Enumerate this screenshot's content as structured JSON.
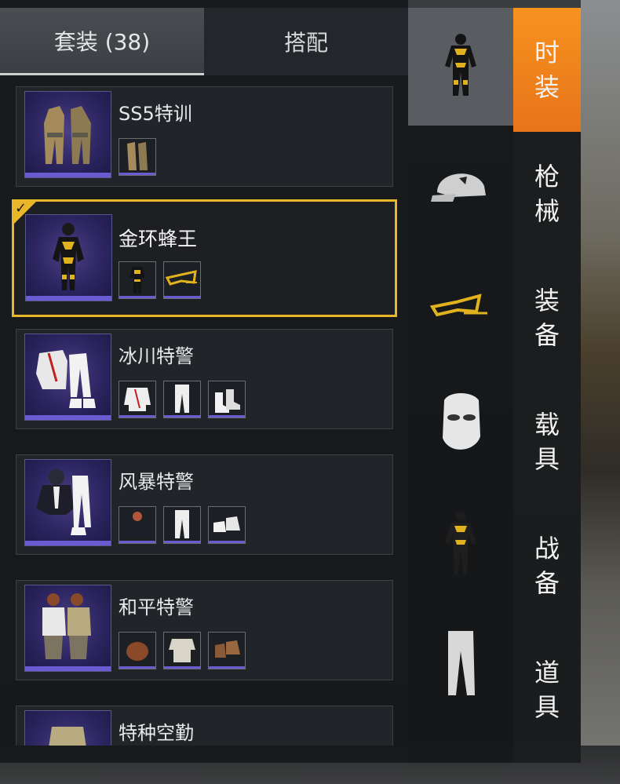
{
  "tabs": [
    {
      "label": "套装 (38)",
      "active": true
    },
    {
      "label": "搭配",
      "active": false
    }
  ],
  "outfits": [
    {
      "name": "SS5特训",
      "selected": false,
      "items": [
        "camo-suit-item"
      ]
    },
    {
      "name": "金环蜂王",
      "selected": true,
      "items": [
        "gold-suit-item",
        "gold-mask-item"
      ]
    },
    {
      "name": "冰川特警",
      "selected": false,
      "items": [
        "white-jacket-item",
        "white-pants-item",
        "white-boots-item"
      ]
    },
    {
      "name": "风暴特警",
      "selected": false,
      "items": [
        "hood-top-item",
        "white-pants-item",
        "white-shoes-item"
      ]
    },
    {
      "name": "和平特警",
      "selected": false,
      "items": [
        "brown-helmet-item",
        "camo-top-item",
        "brown-boots-item"
      ]
    },
    {
      "name": "特种空勤",
      "selected": false,
      "items": []
    }
  ],
  "categories": [
    {
      "icon": "outfit-icon",
      "active": true
    },
    {
      "icon": "cap-icon",
      "active": false
    },
    {
      "icon": "eye-mask-icon",
      "active": false
    },
    {
      "icon": "face-mask-icon",
      "active": false
    },
    {
      "icon": "top-icon",
      "active": false
    },
    {
      "icon": "pants-icon",
      "active": false
    }
  ],
  "main_tabs": [
    {
      "label": "时装",
      "active": true
    },
    {
      "label": "枪械",
      "active": false
    },
    {
      "label": "装备",
      "active": false
    },
    {
      "label": "载具",
      "active": false
    },
    {
      "label": "战备",
      "active": false
    },
    {
      "label": "道具",
      "active": false
    }
  ],
  "colors": {
    "accent": "#f7921f",
    "selected_border": "#e9b62a",
    "rarity": "#6a5bd0"
  }
}
